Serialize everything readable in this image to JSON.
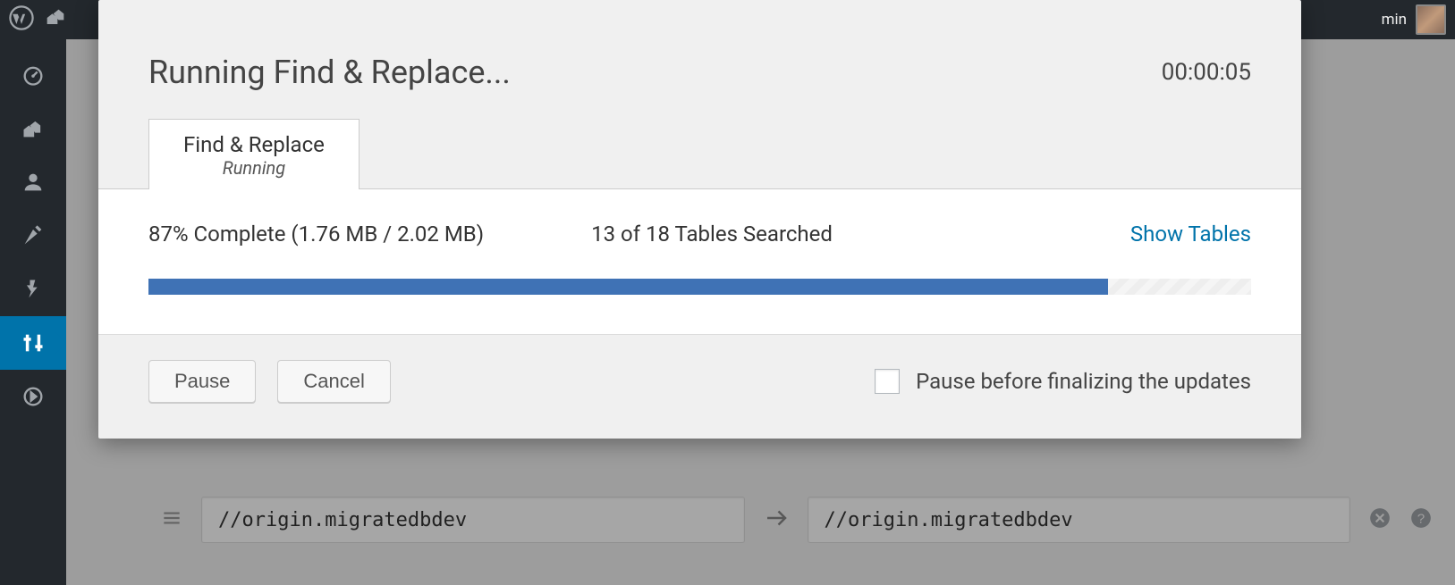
{
  "adminbar": {
    "username_suffix": "min"
  },
  "modal": {
    "title": "Running Find & Replace...",
    "timer": "00:00:05",
    "tab": {
      "label": "Find & Replace",
      "status": "Running"
    },
    "progress": {
      "percent": 87,
      "complete_text": "87% Complete (1.76 MB / 2.02 MB)",
      "tables_text": "13 of 18 Tables Searched",
      "show_tables": "Show Tables"
    },
    "buttons": {
      "pause": "Pause",
      "cancel": "Cancel"
    },
    "checkbox_label": "Pause before finalizing the updates"
  },
  "replace_row": {
    "find_value": "//origin.migratedbdev",
    "replace_value": "//origin.migratedbdev"
  }
}
